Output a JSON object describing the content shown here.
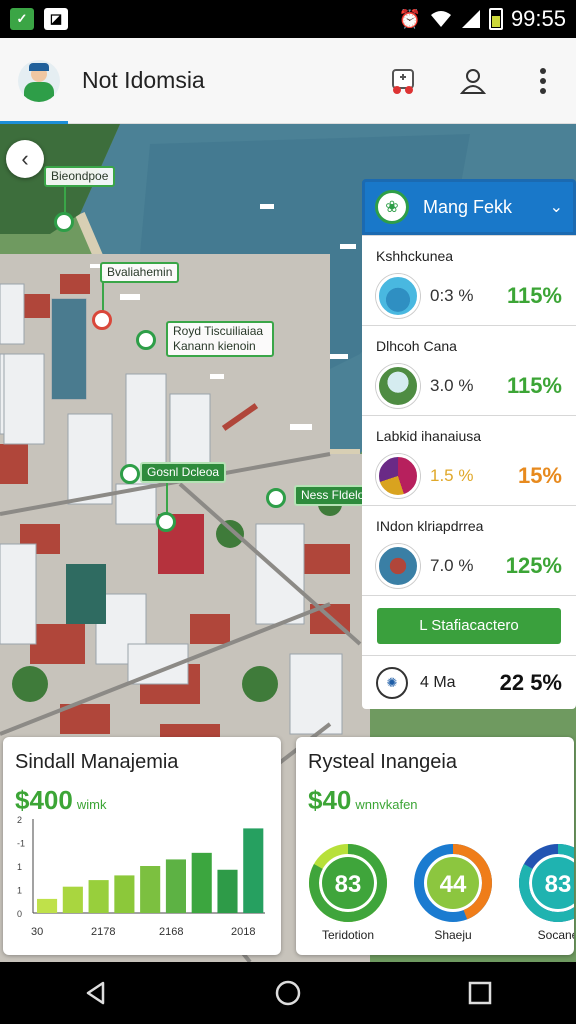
{
  "status_bar": {
    "time": "99:55",
    "left_icons": [
      "app-notification-icon",
      "gallery-icon"
    ],
    "right_icons": [
      "alarm-icon",
      "wifi-icon",
      "signal-icon",
      "battery-icon"
    ]
  },
  "app_bar": {
    "title": "Not Idomsia",
    "actions": [
      "game-controller-icon",
      "profile-icon",
      "more-vert-icon"
    ]
  },
  "map": {
    "labels": [
      "Bieondpoe",
      "Bvaliahemin",
      "Royd Tiscuiliaiaa Kanann kienoin",
      "Gosnl Dcleoa",
      "Ness Fldelon"
    ]
  },
  "panel": {
    "title": "Mang Fekk",
    "items": [
      {
        "name": "Kshhckunea",
        "pct": "0:3 %",
        "value": "115%"
      },
      {
        "name": "Dlhcoh Cana",
        "pct": "3.0 %",
        "value": "115%"
      },
      {
        "name": "Labkid ihanaiusa",
        "pct": "1.5 %",
        "value": "15%"
      },
      {
        "name": "INdon klriapdrrea",
        "pct": "7.0 %",
        "value": "125%"
      }
    ],
    "button_label": "L Stafiacactero",
    "footer": {
      "label": "4 Ma",
      "value": "22 5%"
    },
    "colors": {
      "header": "#1978c9",
      "green": "#3ca536",
      "orange": "#e78a1e"
    }
  },
  "card1": {
    "title": "Sindall Manajemia",
    "amount": "$400",
    "amount_unit": "wimk",
    "chart_data": {
      "type": "bar",
      "y_tick_labels": [
        "2",
        "-1",
        "1",
        "1",
        "0"
      ],
      "x_tick_labels": [
        "30",
        "2178",
        "2168",
        "2018"
      ],
      "values": [
        0.15,
        0.28,
        0.35,
        0.4,
        0.5,
        0.57,
        0.64,
        0.46,
        0.9
      ],
      "colors": [
        "#bfe14a",
        "#a9d63f",
        "#98cf3c",
        "#8cc83a",
        "#7cc040",
        "#5db244",
        "#3ca63f",
        "#2e9b48",
        "#26a060"
      ]
    }
  },
  "card2": {
    "title": "Rysteal Inangeia",
    "amount": "$40",
    "amount_unit": "wnnvkafen",
    "chart_data": {
      "type": "pie",
      "rings": [
        {
          "value": "83",
          "label": "Teridotion",
          "colors": [
            "#3fa53b",
            "#b7e03a"
          ]
        },
        {
          "value": "44",
          "label": "Shaeju",
          "colors": [
            "#ef7d1a",
            "#1b7bd0"
          ]
        },
        {
          "value": "83",
          "label": "Socane",
          "colors": [
            "#1fb3b0",
            "#2254b2"
          ]
        }
      ]
    }
  },
  "nav_bar": {
    "buttons": [
      "back-icon",
      "home-icon",
      "recents-icon"
    ]
  }
}
